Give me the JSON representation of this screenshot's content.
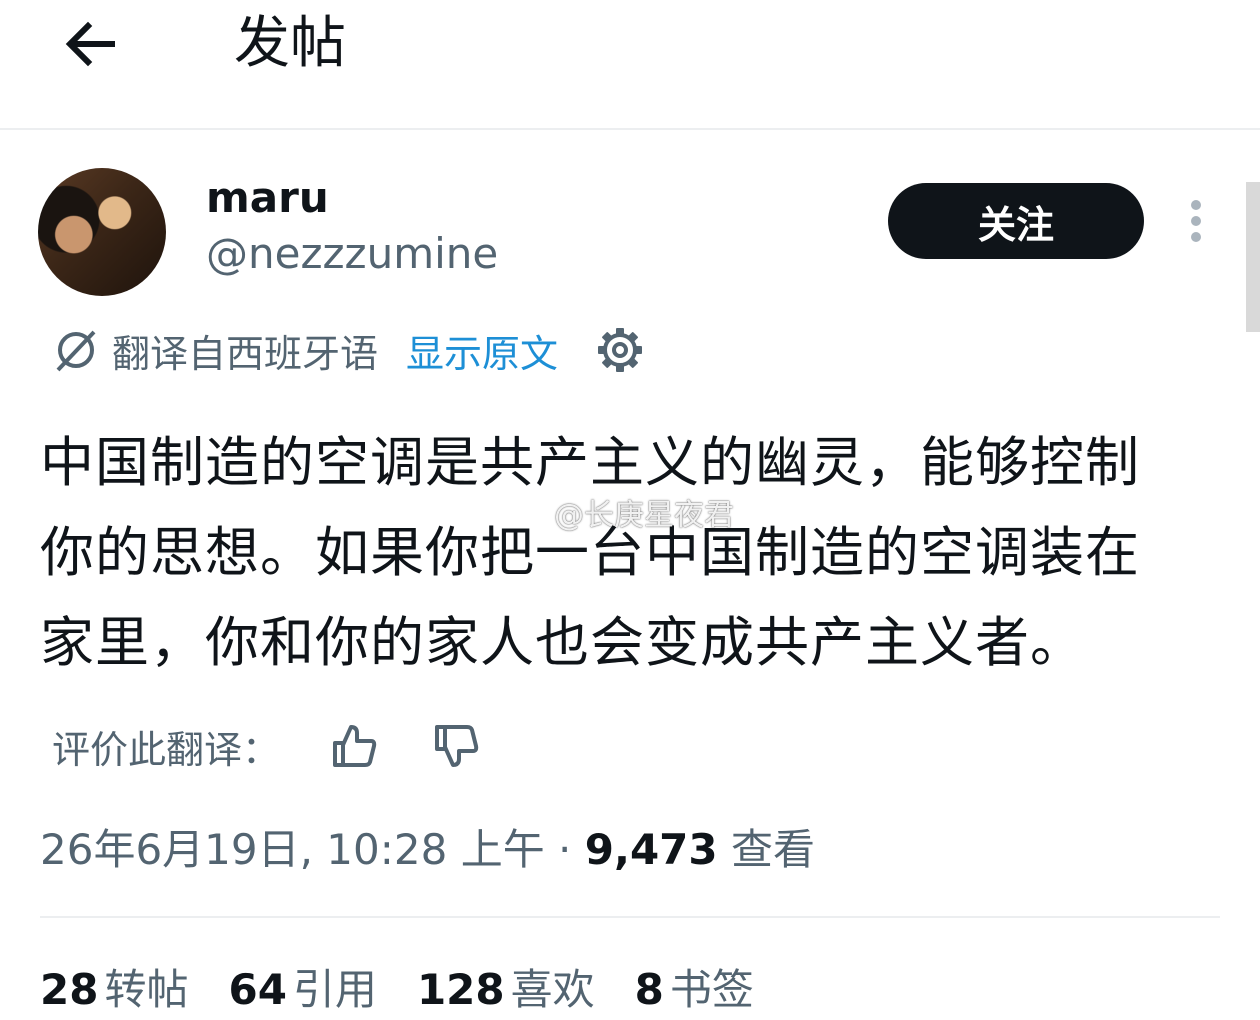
{
  "header": {
    "title": "发帖"
  },
  "author": {
    "name": "maru",
    "handle": "@nezzzumine",
    "follow_label": "关注"
  },
  "translation": {
    "label": "翻译自西班牙语",
    "show_original": "显示原文"
  },
  "post": {
    "lines": [
      "中国制造的空调是共产主义的幽灵，能够控制",
      "你的思想。如果你把一台中国制造的空调装在",
      "家里，你和你的家人也会变成共产主义者。"
    ]
  },
  "watermark": {
    "text": "@长庚星夜君"
  },
  "rate": {
    "label": "评价此翻译："
  },
  "meta": {
    "timestamp": "26年6月19日, 10:28 上午",
    "separator": " · ",
    "views_count": "9,473",
    "views_label": "查看"
  },
  "stats": [
    {
      "count": "28",
      "label": "转帖"
    },
    {
      "count": "64",
      "label": "引用"
    },
    {
      "count": "128",
      "label": "喜欢"
    },
    {
      "count": "8",
      "label": "书签"
    }
  ],
  "colors": {
    "text_primary": "#0f1419",
    "text_secondary": "#536471",
    "link": "#1d8fd6",
    "follow_bg": "#0f1419"
  },
  "icons": [
    "arrow-left-icon",
    "more-vertical-icon",
    "translate-icon",
    "gear-icon",
    "thumbs-up-icon",
    "thumbs-down-icon",
    "weibo-logo-icon"
  ]
}
